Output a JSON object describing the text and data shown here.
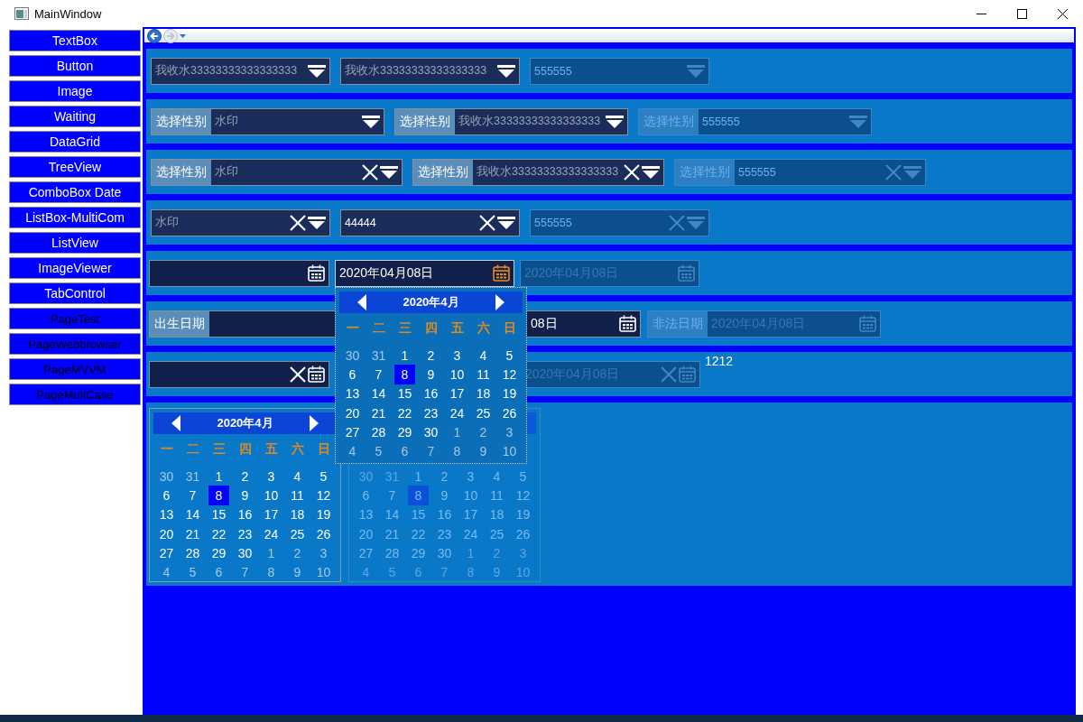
{
  "window": {
    "title": "MainWindow"
  },
  "sidebar": {
    "items": [
      {
        "label": "TextBox",
        "kind": "control"
      },
      {
        "label": "Button",
        "kind": "control"
      },
      {
        "label": "Image",
        "kind": "control"
      },
      {
        "label": "Waiting",
        "kind": "control"
      },
      {
        "label": "DataGrid",
        "kind": "control"
      },
      {
        "label": "TreeView",
        "kind": "control"
      },
      {
        "label": "ComboBox Date",
        "kind": "control"
      },
      {
        "label": "ListBox-MultiCom",
        "kind": "control"
      },
      {
        "label": "ListView",
        "kind": "control"
      },
      {
        "label": "ImageViewer",
        "kind": "control"
      },
      {
        "label": "TabControl",
        "kind": "control"
      },
      {
        "label": "PageTest",
        "kind": "page"
      },
      {
        "label": "PageWebbrowser",
        "kind": "page"
      },
      {
        "label": "PageMVVM",
        "kind": "page"
      },
      {
        "label": "PageMultCase",
        "kind": "page"
      }
    ]
  },
  "combo_rows": [
    {
      "items": [
        {
          "placeholder": "我收水33333333333333333",
          "clearable": false,
          "disabled": false
        },
        {
          "placeholder": "我收水33333333333333333",
          "clearable": false,
          "disabled": false
        },
        {
          "value": "555555",
          "clearable": false,
          "disabled": true
        }
      ]
    },
    {
      "items": [
        {
          "label": "选择性别",
          "placeholder": "水印",
          "clearable": false,
          "disabled": false
        },
        {
          "label": "选择性别",
          "placeholder": "我收水33333333333333333",
          "clearable": false,
          "disabled": false
        },
        {
          "label": "选择性别",
          "value": "555555",
          "clearable": false,
          "disabled": true
        }
      ]
    },
    {
      "items": [
        {
          "label": "选择性别",
          "placeholder": "水印",
          "clearable": true,
          "disabled": false
        },
        {
          "label": "选择性别",
          "placeholder": "我收水33333333333333333",
          "clearable": true,
          "disabled": false
        },
        {
          "label": "选择性别",
          "value": "555555",
          "clearable": true,
          "disabled": true
        }
      ]
    },
    {
      "items": [
        {
          "placeholder": "水印",
          "clearable": true,
          "disabled": false
        },
        {
          "value": "44444",
          "clearable": true,
          "disabled": false
        },
        {
          "value": "555555",
          "clearable": true,
          "disabled": true
        }
      ]
    }
  ],
  "date_rows": [
    {
      "items": [
        {
          "clearable": false,
          "disabled": false,
          "open": false
        },
        {
          "value": "2020年04月08日",
          "clearable": false,
          "disabled": false,
          "open": true
        },
        {
          "value": "2020年04月08日",
          "clearable": false,
          "disabled": true,
          "open": false
        }
      ]
    },
    {
      "items": [
        {
          "label": "出生日期",
          "value": "08日",
          "clearable": false,
          "disabled": false,
          "open": false
        },
        {
          "label": "非法日期",
          "value": "2020年04月08日",
          "clearable": false,
          "disabled": true,
          "open": false
        }
      ]
    },
    {
      "items": [
        {
          "clearable": true,
          "disabled": false,
          "open": false
        },
        {
          "value": "2020年04月08日",
          "clearable": true,
          "disabled": true,
          "open": false
        }
      ],
      "note": "1212"
    }
  ],
  "calendars": [
    {
      "title": "2020年4月",
      "weekdays": [
        "一",
        "二",
        "三",
        "四",
        "五",
        "六",
        "日"
      ],
      "disabled": false,
      "days": [
        {
          "day": "30",
          "other_month": true,
          "selected": false
        },
        {
          "day": "31",
          "other_month": true,
          "selected": false
        },
        {
          "day": "1",
          "other_month": false,
          "selected": false
        },
        {
          "day": "2",
          "other_month": false,
          "selected": false
        },
        {
          "day": "3",
          "other_month": false,
          "selected": false
        },
        {
          "day": "4",
          "other_month": false,
          "selected": false
        },
        {
          "day": "5",
          "other_month": false,
          "selected": false
        },
        {
          "day": "6",
          "other_month": false,
          "selected": false
        },
        {
          "day": "7",
          "other_month": false,
          "selected": false
        },
        {
          "day": "8",
          "other_month": false,
          "selected": true
        },
        {
          "day": "9",
          "other_month": false,
          "selected": false
        },
        {
          "day": "10",
          "other_month": false,
          "selected": false
        },
        {
          "day": "11",
          "other_month": false,
          "selected": false
        },
        {
          "day": "12",
          "other_month": false,
          "selected": false
        },
        {
          "day": "13",
          "other_month": false,
          "selected": false
        },
        {
          "day": "14",
          "other_month": false,
          "selected": false
        },
        {
          "day": "15",
          "other_month": false,
          "selected": false
        },
        {
          "day": "16",
          "other_month": false,
          "selected": false
        },
        {
          "day": "17",
          "other_month": false,
          "selected": false
        },
        {
          "day": "18",
          "other_month": false,
          "selected": false
        },
        {
          "day": "19",
          "other_month": false,
          "selected": false
        },
        {
          "day": "20",
          "other_month": false,
          "selected": false
        },
        {
          "day": "21",
          "other_month": false,
          "selected": false
        },
        {
          "day": "22",
          "other_month": false,
          "selected": false
        },
        {
          "day": "23",
          "other_month": false,
          "selected": false
        },
        {
          "day": "24",
          "other_month": false,
          "selected": false
        },
        {
          "day": "25",
          "other_month": false,
          "selected": false
        },
        {
          "day": "26",
          "other_month": false,
          "selected": false
        },
        {
          "day": "27",
          "other_month": false,
          "selected": false
        },
        {
          "day": "28",
          "other_month": false,
          "selected": false
        },
        {
          "day": "29",
          "other_month": false,
          "selected": false
        },
        {
          "day": "30",
          "other_month": false,
          "selected": false
        },
        {
          "day": "1",
          "other_month": true,
          "selected": false
        },
        {
          "day": "2",
          "other_month": true,
          "selected": false
        },
        {
          "day": "3",
          "other_month": true,
          "selected": false
        },
        {
          "day": "4",
          "other_month": true,
          "selected": false
        },
        {
          "day": "5",
          "other_month": true,
          "selected": false
        },
        {
          "day": "6",
          "other_month": true,
          "selected": false
        },
        {
          "day": "7",
          "other_month": true,
          "selected": false
        },
        {
          "day": "8",
          "other_month": true,
          "selected": false
        },
        {
          "day": "9",
          "other_month": true,
          "selected": false
        },
        {
          "day": "10",
          "other_month": true,
          "selected": false
        }
      ]
    },
    {
      "disabled": true,
      "days": [
        {
          "day": "30",
          "other_month": true,
          "selected": false
        },
        {
          "day": "31",
          "other_month": true,
          "selected": false
        },
        {
          "day": "1",
          "other_month": false,
          "selected": false
        },
        {
          "day": "2",
          "other_month": false,
          "selected": false
        },
        {
          "day": "3",
          "other_month": false,
          "selected": false
        },
        {
          "day": "4",
          "other_month": false,
          "selected": false
        },
        {
          "day": "5",
          "other_month": false,
          "selected": false
        },
        {
          "day": "6",
          "other_month": false,
          "selected": false
        },
        {
          "day": "7",
          "other_month": false,
          "selected": false
        },
        {
          "day": "8",
          "other_month": false,
          "selected": true
        },
        {
          "day": "9",
          "other_month": false,
          "selected": false
        },
        {
          "day": "10",
          "other_month": false,
          "selected": false
        },
        {
          "day": "11",
          "other_month": false,
          "selected": false
        },
        {
          "day": "12",
          "other_month": false,
          "selected": false
        },
        {
          "day": "13",
          "other_month": false,
          "selected": false
        },
        {
          "day": "14",
          "other_month": false,
          "selected": false
        },
        {
          "day": "15",
          "other_month": false,
          "selected": false
        },
        {
          "day": "16",
          "other_month": false,
          "selected": false
        },
        {
          "day": "17",
          "other_month": false,
          "selected": false
        },
        {
          "day": "18",
          "other_month": false,
          "selected": false
        },
        {
          "day": "19",
          "other_month": false,
          "selected": false
        },
        {
          "day": "20",
          "other_month": false,
          "selected": false
        },
        {
          "day": "21",
          "other_month": false,
          "selected": false
        },
        {
          "day": "22",
          "other_month": false,
          "selected": false
        },
        {
          "day": "23",
          "other_month": false,
          "selected": false
        },
        {
          "day": "24",
          "other_month": false,
          "selected": false
        },
        {
          "day": "25",
          "other_month": false,
          "selected": false
        },
        {
          "day": "26",
          "other_month": false,
          "selected": false
        },
        {
          "day": "27",
          "other_month": false,
          "selected": false
        },
        {
          "day": "28",
          "other_month": false,
          "selected": false
        },
        {
          "day": "29",
          "other_month": false,
          "selected": false
        },
        {
          "day": "30",
          "other_month": false,
          "selected": false
        },
        {
          "day": "1",
          "other_month": true,
          "selected": false
        },
        {
          "day": "2",
          "other_month": true,
          "selected": false
        },
        {
          "day": "3",
          "other_month": true,
          "selected": false
        },
        {
          "day": "4",
          "other_month": true,
          "selected": false
        },
        {
          "day": "5",
          "other_month": true,
          "selected": false
        },
        {
          "day": "6",
          "other_month": true,
          "selected": false
        },
        {
          "day": "7",
          "other_month": true,
          "selected": false
        },
        {
          "day": "8",
          "other_month": true,
          "selected": false
        },
        {
          "day": "9",
          "other_month": true,
          "selected": false
        },
        {
          "day": "10",
          "other_month": true,
          "selected": false
        }
      ]
    }
  ],
  "popup_calendar": {
    "title": "2020年4月",
    "weekdays": [
      "一",
      "二",
      "三",
      "四",
      "五",
      "六",
      "日"
    ],
    "disabled": false,
    "days": [
      {
        "day": "30",
        "other_month": true,
        "selected": false
      },
      {
        "day": "31",
        "other_month": true,
        "selected": false
      },
      {
        "day": "1",
        "other_month": false,
        "selected": false
      },
      {
        "day": "2",
        "other_month": false,
        "selected": false
      },
      {
        "day": "3",
        "other_month": false,
        "selected": false
      },
      {
        "day": "4",
        "other_month": false,
        "selected": false
      },
      {
        "day": "5",
        "other_month": false,
        "selected": false
      },
      {
        "day": "6",
        "other_month": false,
        "selected": false
      },
      {
        "day": "7",
        "other_month": false,
        "selected": false
      },
      {
        "day": "8",
        "other_month": false,
        "selected": true
      },
      {
        "day": "9",
        "other_month": false,
        "selected": false
      },
      {
        "day": "10",
        "other_month": false,
        "selected": false
      },
      {
        "day": "11",
        "other_month": false,
        "selected": false
      },
      {
        "day": "12",
        "other_month": false,
        "selected": false
      },
      {
        "day": "13",
        "other_month": false,
        "selected": false
      },
      {
        "day": "14",
        "other_month": false,
        "selected": false
      },
      {
        "day": "15",
        "other_month": false,
        "selected": false
      },
      {
        "day": "16",
        "other_month": false,
        "selected": false
      },
      {
        "day": "17",
        "other_month": false,
        "selected": false
      },
      {
        "day": "18",
        "other_month": false,
        "selected": false
      },
      {
        "day": "19",
        "other_month": false,
        "selected": false
      },
      {
        "day": "20",
        "other_month": false,
        "selected": false
      },
      {
        "day": "21",
        "other_month": false,
        "selected": false
      },
      {
        "day": "22",
        "other_month": false,
        "selected": false
      },
      {
        "day": "23",
        "other_month": false,
        "selected": false
      },
      {
        "day": "24",
        "other_month": false,
        "selected": false
      },
      {
        "day": "25",
        "other_month": false,
        "selected": false
      },
      {
        "day": "26",
        "other_month": false,
        "selected": false
      },
      {
        "day": "27",
        "other_month": false,
        "selected": false
      },
      {
        "day": "28",
        "other_month": false,
        "selected": false
      },
      {
        "day": "29",
        "other_month": false,
        "selected": false
      },
      {
        "day": "30",
        "other_month": false,
        "selected": false
      },
      {
        "day": "1",
        "other_month": true,
        "selected": false
      },
      {
        "day": "2",
        "other_month": true,
        "selected": false
      },
      {
        "day": "3",
        "other_month": true,
        "selected": false
      },
      {
        "day": "4",
        "other_month": true,
        "selected": false
      },
      {
        "day": "5",
        "other_month": true,
        "selected": false
      },
      {
        "day": "6",
        "other_month": true,
        "selected": false
      },
      {
        "day": "7",
        "other_month": true,
        "selected": false
      },
      {
        "day": "8",
        "other_month": true,
        "selected": false
      },
      {
        "day": "9",
        "other_month": true,
        "selected": false
      },
      {
        "day": "10",
        "other_month": true,
        "selected": false
      }
    ]
  }
}
